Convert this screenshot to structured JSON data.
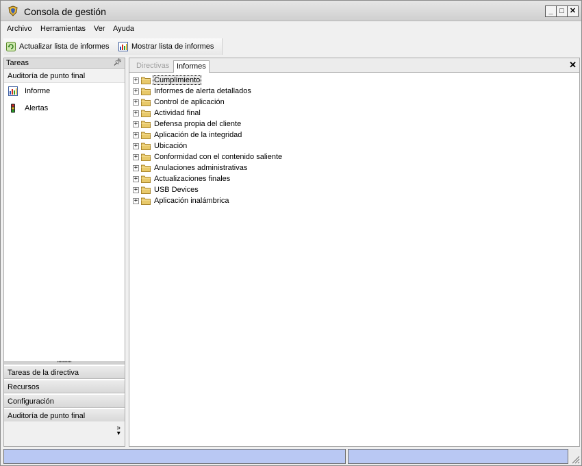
{
  "window": {
    "title": "Consola de gestión",
    "icon": "shield-app-icon",
    "controls": [
      "minimize",
      "maximize",
      "close"
    ]
  },
  "menubar": {
    "items": [
      "Archivo",
      "Herramientas",
      "Ver",
      "Ayuda"
    ]
  },
  "toolbar": {
    "refresh_label": "Actualizar lista de informes",
    "show_label": "Mostrar lista de informes"
  },
  "left_panel": {
    "header": "Tareas",
    "section_title": "Auditoría de punto final",
    "items": [
      {
        "label": "Informe",
        "icon": "report-chart-icon"
      },
      {
        "label": "Alertas",
        "icon": "traffic-light-icon"
      }
    ],
    "nav": [
      "Tareas de la directiva",
      "Recursos",
      "Configuración",
      "Auditoría de punto final"
    ]
  },
  "right_panel": {
    "tabs": [
      {
        "label": "Directivas",
        "active": false
      },
      {
        "label": "Informes",
        "active": true
      }
    ],
    "tree": [
      {
        "label": "Cumplimiento",
        "selected": true
      },
      {
        "label": "Informes de alerta detallados",
        "selected": false
      },
      {
        "label": "Control de aplicación",
        "selected": false
      },
      {
        "label": "Actividad final",
        "selected": false
      },
      {
        "label": "Defensa propia del cliente",
        "selected": false
      },
      {
        "label": "Aplicación de la integridad",
        "selected": false
      },
      {
        "label": "Ubicación",
        "selected": false
      },
      {
        "label": "Conformidad con el contenido saliente",
        "selected": false
      },
      {
        "label": "Anulaciones administrativas",
        "selected": false
      },
      {
        "label": "Actualizaciones finales",
        "selected": false
      },
      {
        "label": "USB Devices",
        "selected": false
      },
      {
        "label": "Aplicación inalámbrica",
        "selected": false
      }
    ]
  },
  "colors": {
    "status_pane": "#b9c8f3",
    "folder": "#e8c96a"
  }
}
